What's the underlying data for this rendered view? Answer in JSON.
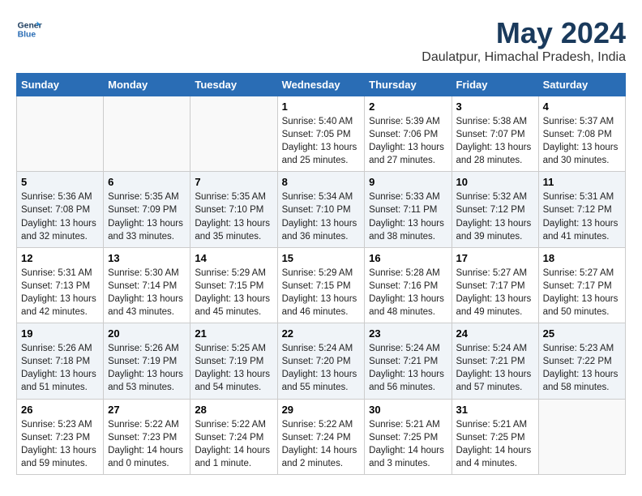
{
  "logo": {
    "line1": "General",
    "line2": "Blue"
  },
  "title": "May 2024",
  "subtitle": "Daulatpur, Himachal Pradesh, India",
  "headers": [
    "Sunday",
    "Monday",
    "Tuesday",
    "Wednesday",
    "Thursday",
    "Friday",
    "Saturday"
  ],
  "weeks": [
    [
      {
        "day": "",
        "content": ""
      },
      {
        "day": "",
        "content": ""
      },
      {
        "day": "",
        "content": ""
      },
      {
        "day": "1",
        "content": "Sunrise: 5:40 AM\nSunset: 7:05 PM\nDaylight: 13 hours and 25 minutes."
      },
      {
        "day": "2",
        "content": "Sunrise: 5:39 AM\nSunset: 7:06 PM\nDaylight: 13 hours and 27 minutes."
      },
      {
        "day": "3",
        "content": "Sunrise: 5:38 AM\nSunset: 7:07 PM\nDaylight: 13 hours and 28 minutes."
      },
      {
        "day": "4",
        "content": "Sunrise: 5:37 AM\nSunset: 7:08 PM\nDaylight: 13 hours and 30 minutes."
      }
    ],
    [
      {
        "day": "5",
        "content": "Sunrise: 5:36 AM\nSunset: 7:08 PM\nDaylight: 13 hours and 32 minutes."
      },
      {
        "day": "6",
        "content": "Sunrise: 5:35 AM\nSunset: 7:09 PM\nDaylight: 13 hours and 33 minutes."
      },
      {
        "day": "7",
        "content": "Sunrise: 5:35 AM\nSunset: 7:10 PM\nDaylight: 13 hours and 35 minutes."
      },
      {
        "day": "8",
        "content": "Sunrise: 5:34 AM\nSunset: 7:10 PM\nDaylight: 13 hours and 36 minutes."
      },
      {
        "day": "9",
        "content": "Sunrise: 5:33 AM\nSunset: 7:11 PM\nDaylight: 13 hours and 38 minutes."
      },
      {
        "day": "10",
        "content": "Sunrise: 5:32 AM\nSunset: 7:12 PM\nDaylight: 13 hours and 39 minutes."
      },
      {
        "day": "11",
        "content": "Sunrise: 5:31 AM\nSunset: 7:12 PM\nDaylight: 13 hours and 41 minutes."
      }
    ],
    [
      {
        "day": "12",
        "content": "Sunrise: 5:31 AM\nSunset: 7:13 PM\nDaylight: 13 hours and 42 minutes."
      },
      {
        "day": "13",
        "content": "Sunrise: 5:30 AM\nSunset: 7:14 PM\nDaylight: 13 hours and 43 minutes."
      },
      {
        "day": "14",
        "content": "Sunrise: 5:29 AM\nSunset: 7:15 PM\nDaylight: 13 hours and 45 minutes."
      },
      {
        "day": "15",
        "content": "Sunrise: 5:29 AM\nSunset: 7:15 PM\nDaylight: 13 hours and 46 minutes."
      },
      {
        "day": "16",
        "content": "Sunrise: 5:28 AM\nSunset: 7:16 PM\nDaylight: 13 hours and 48 minutes."
      },
      {
        "day": "17",
        "content": "Sunrise: 5:27 AM\nSunset: 7:17 PM\nDaylight: 13 hours and 49 minutes."
      },
      {
        "day": "18",
        "content": "Sunrise: 5:27 AM\nSunset: 7:17 PM\nDaylight: 13 hours and 50 minutes."
      }
    ],
    [
      {
        "day": "19",
        "content": "Sunrise: 5:26 AM\nSunset: 7:18 PM\nDaylight: 13 hours and 51 minutes."
      },
      {
        "day": "20",
        "content": "Sunrise: 5:26 AM\nSunset: 7:19 PM\nDaylight: 13 hours and 53 minutes."
      },
      {
        "day": "21",
        "content": "Sunrise: 5:25 AM\nSunset: 7:19 PM\nDaylight: 13 hours and 54 minutes."
      },
      {
        "day": "22",
        "content": "Sunrise: 5:24 AM\nSunset: 7:20 PM\nDaylight: 13 hours and 55 minutes."
      },
      {
        "day": "23",
        "content": "Sunrise: 5:24 AM\nSunset: 7:21 PM\nDaylight: 13 hours and 56 minutes."
      },
      {
        "day": "24",
        "content": "Sunrise: 5:24 AM\nSunset: 7:21 PM\nDaylight: 13 hours and 57 minutes."
      },
      {
        "day": "25",
        "content": "Sunrise: 5:23 AM\nSunset: 7:22 PM\nDaylight: 13 hours and 58 minutes."
      }
    ],
    [
      {
        "day": "26",
        "content": "Sunrise: 5:23 AM\nSunset: 7:23 PM\nDaylight: 13 hours and 59 minutes."
      },
      {
        "day": "27",
        "content": "Sunrise: 5:22 AM\nSunset: 7:23 PM\nDaylight: 14 hours and 0 minutes."
      },
      {
        "day": "28",
        "content": "Sunrise: 5:22 AM\nSunset: 7:24 PM\nDaylight: 14 hours and 1 minute."
      },
      {
        "day": "29",
        "content": "Sunrise: 5:22 AM\nSunset: 7:24 PM\nDaylight: 14 hours and 2 minutes."
      },
      {
        "day": "30",
        "content": "Sunrise: 5:21 AM\nSunset: 7:25 PM\nDaylight: 14 hours and 3 minutes."
      },
      {
        "day": "31",
        "content": "Sunrise: 5:21 AM\nSunset: 7:25 PM\nDaylight: 14 hours and 4 minutes."
      },
      {
        "day": "",
        "content": ""
      }
    ]
  ]
}
